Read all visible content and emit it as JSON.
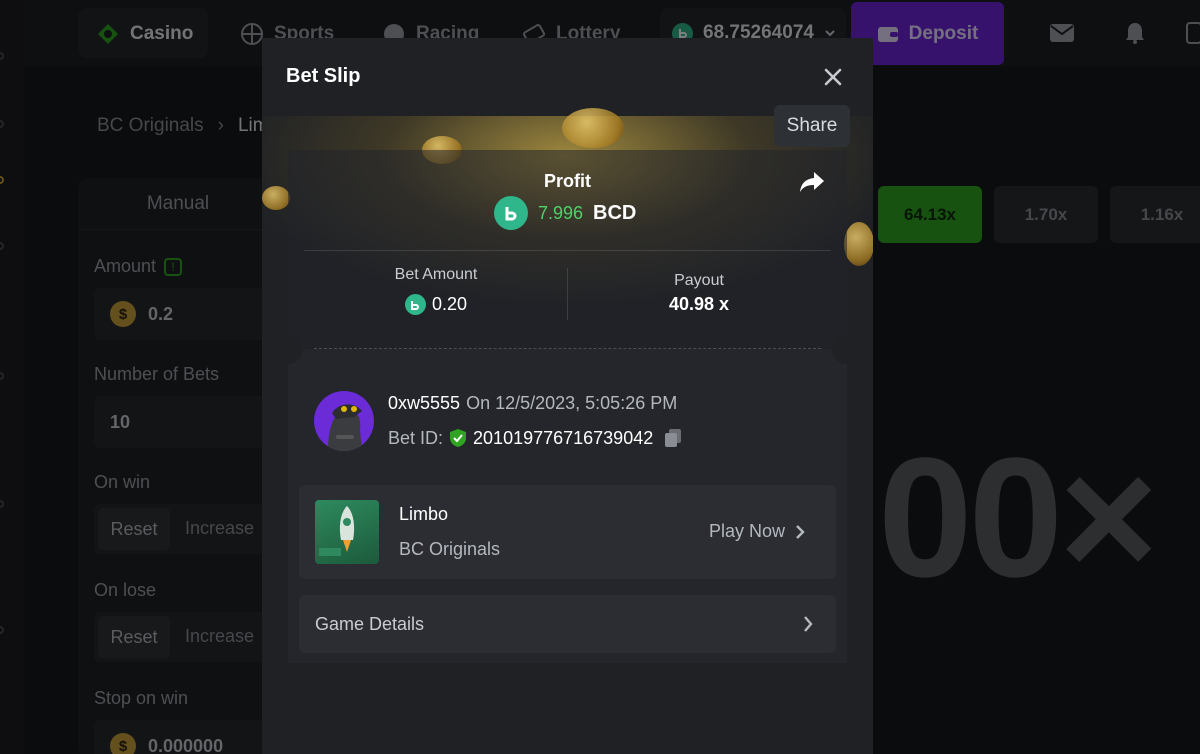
{
  "topnav": {
    "casino": "Casino",
    "sports": "Sports",
    "racing": "Racing",
    "lottery": "Lottery",
    "balance": "68.75264074",
    "deposit": "Deposit"
  },
  "breadcrumb": {
    "root": "BC Originals",
    "current": "Lim"
  },
  "bet_panel": {
    "mode_tab": "Manual",
    "amount_label": "Amount",
    "amount_value": "0.2",
    "bets_label": "Number of Bets",
    "bets_value": "10",
    "on_win_label": "On win",
    "on_lose_label": "On lose",
    "reset": "Reset",
    "increase": "Increase",
    "stop_win_label": "Stop on win",
    "stop_win_value": "0.000000",
    "coin_symbol": "$"
  },
  "history": [
    "64.13x",
    "1.70x",
    "1.16x"
  ],
  "big_multiplier": "00×",
  "modal": {
    "title": "Bet Slip",
    "share_tooltip": "Share",
    "profit_label": "Profit",
    "profit_value": "7.996",
    "profit_currency": "BCD",
    "bet_amount_label": "Bet Amount",
    "bet_amount_value": "0.20",
    "payout_label": "Payout",
    "payout_value": "40.98 x",
    "username": "0xw5555",
    "date": "On 12/5/2023, 5:05:26 PM",
    "bet_id_label": "Bet ID:",
    "bet_id_value": "201019776716739042",
    "game_name": "Limbo",
    "game_provider": "BC Originals",
    "play_now": "Play Now",
    "game_details": "Game Details"
  },
  "colors": {
    "accent_green": "#4fd16a",
    "deposit_purple": "#6f24d8",
    "bc_coin": "#2fb68a",
    "history_win": "#2fa421"
  }
}
